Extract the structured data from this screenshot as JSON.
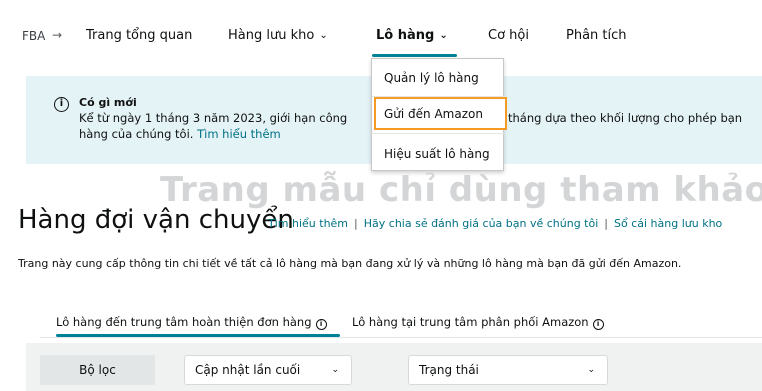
{
  "topnav": {
    "crumb": "FBA",
    "crumb_arrow": "→",
    "items": [
      {
        "label": "Trang tổng quan"
      },
      {
        "label": "Hàng lưu kho"
      },
      {
        "label": "Lô hàng"
      },
      {
        "label": "Cơ hội"
      },
      {
        "label": "Phân tích"
      }
    ],
    "dropdown_chevron": "⌄"
  },
  "banner": {
    "title": "Có gì mới",
    "text_line1_a": "Kể từ ngày 1 tháng 3 năm 2023, giới hạn công",
    "text_line1_b": "tháng dựa theo khối lượng cho phép bạn",
    "text_line2": "hàng của chúng tôi.",
    "link": "Tìm hiểu thêm",
    "icon": "info-icon"
  },
  "dropdown": {
    "items": [
      {
        "label": "Quản lý lô hàng"
      },
      {
        "label": "Gửi đến Amazon"
      },
      {
        "label": "Hiệu suất lô hàng"
      }
    ],
    "highlight_color": "#f59a23"
  },
  "watermark": "Trang mẫu chỉ dùng tham khảo",
  "page": {
    "title": "Hàng đợi vận chuyển",
    "links": [
      "Tìm hiểu thêm",
      "Hãy chia sẻ đánh giá của bạn về chúng tôi",
      "Sổ cái hàng lưu kho"
    ],
    "separator": "|",
    "description": "Trang này cung cấp thông tin chi tiết về tất cả lô hàng mà bạn đang xử lý và những lô hàng mà bạn đã gửi đến Amazon."
  },
  "tabs": [
    {
      "label": "Lô hàng đến trung tâm hoàn thiện đơn hàng",
      "active": true
    },
    {
      "label": "Lô hàng tại trung tâm phân phối Amazon",
      "active": false
    }
  ],
  "filters": {
    "filter_button": "Bộ lọc",
    "last_updated": "Cập nhật lần cuối",
    "status": "Trạng thái",
    "chevron": "⌄"
  },
  "colors": {
    "accent": "#008296",
    "link": "#007185",
    "banner_bg": "#e4f3f6",
    "highlight": "#f59a23"
  }
}
